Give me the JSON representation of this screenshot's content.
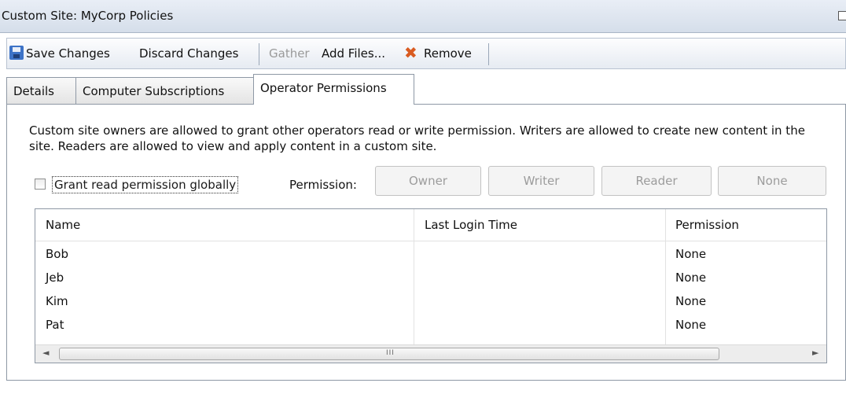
{
  "window": {
    "title": "Custom Site: MyCorp Policies"
  },
  "toolbar": {
    "save_label": "Save Changes",
    "discard_label": "Discard Changes",
    "gather_label": "Gather",
    "add_files_label": "Add Files...",
    "remove_label": "Remove",
    "remove_glyph": "✖"
  },
  "tabs": [
    {
      "label": "Details"
    },
    {
      "label": "Computer Subscriptions"
    },
    {
      "label": "Operator Permissions",
      "active": true
    }
  ],
  "permissions_panel": {
    "description": "Custom site owners are allowed to grant other operators read or write permission. Writers are allowed to create new content in the site. Readers are allowed to view and apply content in a custom site.",
    "global_checkbox_label": "Grant read permission globally",
    "global_checkbox_checked": false,
    "permission_label": "Permission:",
    "buttons": {
      "owner": "Owner",
      "writer": "Writer",
      "reader": "Reader",
      "none": "None"
    }
  },
  "operators_table": {
    "columns": [
      "Name",
      "Last Login Time",
      "Permission"
    ],
    "rows": [
      {
        "name": "Bob",
        "last_login": "",
        "permission": "None"
      },
      {
        "name": "Jeb",
        "last_login": "",
        "permission": "None"
      },
      {
        "name": "Kim",
        "last_login": "",
        "permission": "None"
      },
      {
        "name": "Pat",
        "last_login": "",
        "permission": "None"
      }
    ],
    "scrollbar": {
      "left_arrow": "◄",
      "right_arrow": "►",
      "grip": "III"
    }
  }
}
